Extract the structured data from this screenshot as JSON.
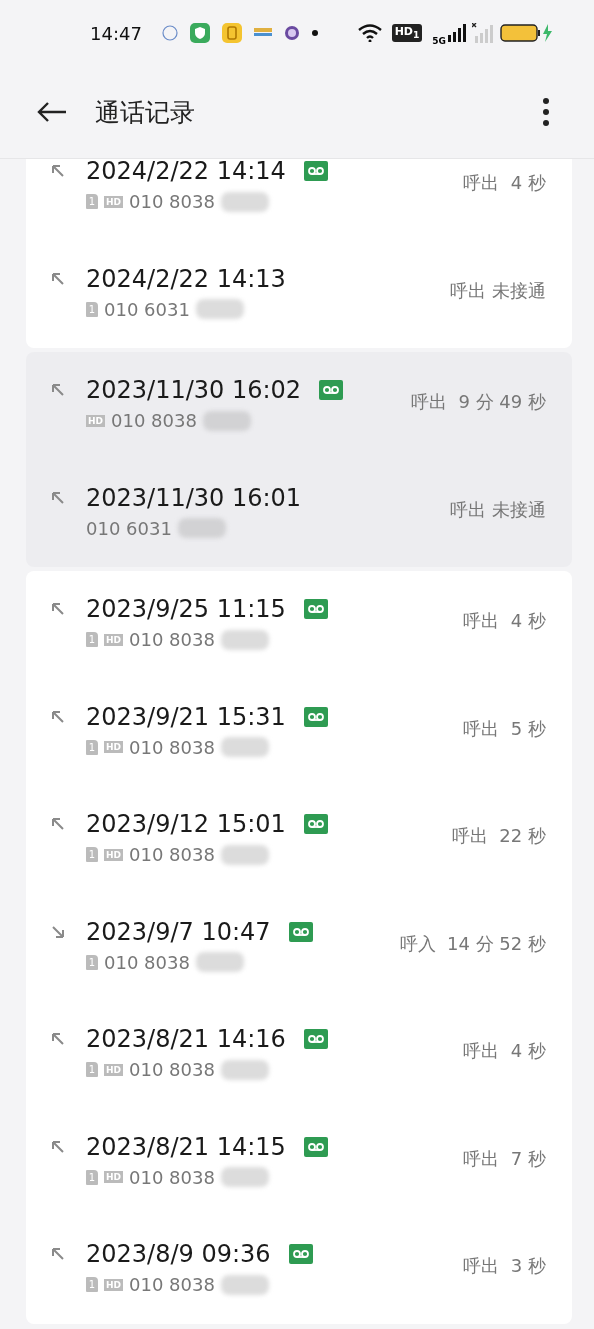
{
  "status_bar": {
    "time": "14:47",
    "hd_badge": "HD$_{1}$",
    "network": "5G"
  },
  "header": {
    "title": "通话记录"
  },
  "groups": [
    {
      "shaded": false,
      "calls": [
        {
          "kind": "outgoing",
          "datetime": "2024/2/22 14:14",
          "recorded": true,
          "sim": "1",
          "hd": "HD",
          "number": "010 8038",
          "result": "呼出  4 秒"
        },
        {
          "kind": "outgoing",
          "datetime": "2024/2/22 14:13",
          "recorded": false,
          "sim": "1",
          "number": "010 6031",
          "result": "呼出 未接通"
        }
      ]
    },
    {
      "shaded": true,
      "calls": [
        {
          "kind": "outgoing",
          "datetime": "2023/11/30 16:02",
          "recorded": true,
          "hd": "HD",
          "number": "010 8038",
          "result": "呼出  9 分 49 秒"
        },
        {
          "kind": "outgoing",
          "datetime": "2023/11/30 16:01",
          "recorded": false,
          "number": "010 6031",
          "result": "呼出 未接通"
        }
      ]
    },
    {
      "shaded": false,
      "calls": [
        {
          "kind": "outgoing",
          "datetime": "2023/9/25 11:15",
          "recorded": true,
          "sim": "1",
          "hd": "HD",
          "number": "010 8038",
          "result": "呼出  4 秒"
        },
        {
          "kind": "outgoing",
          "datetime": "2023/9/21 15:31",
          "recorded": true,
          "sim": "1",
          "hd": "HD",
          "number": "010 8038",
          "result": "呼出  5 秒"
        },
        {
          "kind": "outgoing",
          "datetime": "2023/9/12 15:01",
          "recorded": true,
          "sim": "1",
          "hd": "HD",
          "number": "010 8038",
          "result": "呼出  22 秒"
        },
        {
          "kind": "incoming",
          "datetime": "2023/9/7 10:47",
          "recorded": true,
          "sim": "1",
          "number": "010 8038",
          "result": "呼入  14 分 52 秒"
        },
        {
          "kind": "outgoing",
          "datetime": "2023/8/21 14:16",
          "recorded": true,
          "sim": "1",
          "hd": "HD",
          "number": "010 8038",
          "result": "呼出  4 秒"
        },
        {
          "kind": "outgoing",
          "datetime": "2023/8/21 14:15",
          "recorded": true,
          "sim": "1",
          "hd": "HD",
          "number": "010 8038",
          "result": "呼出  7 秒"
        },
        {
          "kind": "outgoing",
          "datetime": "2023/8/9 09:36",
          "recorded": true,
          "sim": "1",
          "hd": "HD",
          "number": "010 8038",
          "result": "呼出  3 秒"
        }
      ]
    }
  ]
}
